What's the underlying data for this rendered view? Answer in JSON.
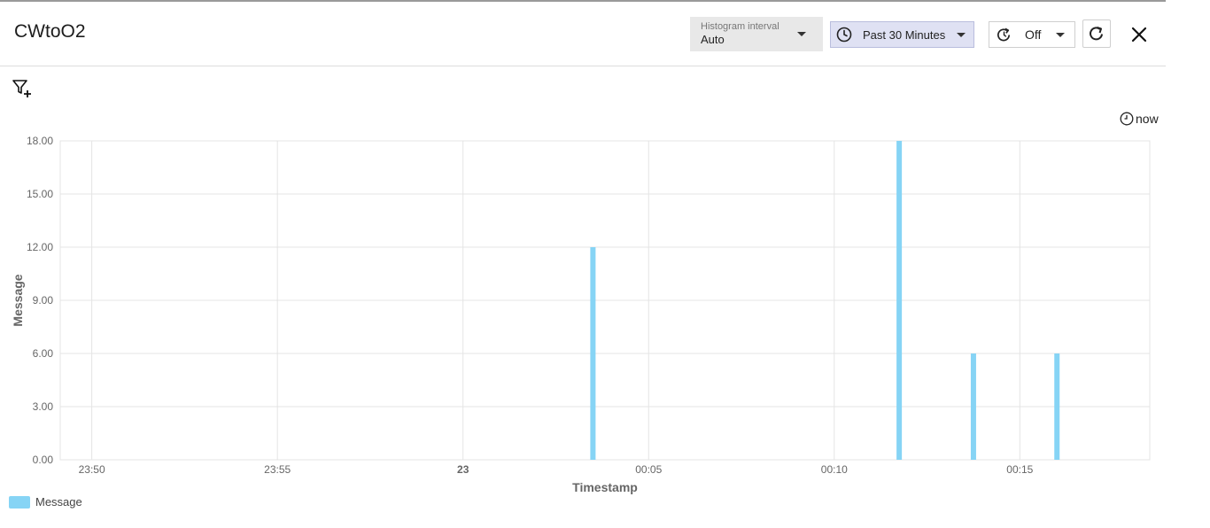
{
  "header": {
    "title": "CWtoO2",
    "histogram_interval": {
      "label": "Histogram interval",
      "value": "Auto"
    },
    "time_range": "Past 30 Minutes",
    "auto_refresh": "Off"
  },
  "icons": [
    "filter-add-icon",
    "clock-icon",
    "refresh-icon",
    "close-icon",
    "chevron-down-icon"
  ],
  "now_label": "now",
  "legend": {
    "label": "Message",
    "color": "#86d4f5"
  },
  "chart_data": {
    "type": "bar",
    "title": "",
    "xlabel": "Timestamp",
    "ylabel": "Message",
    "ylim": [
      0,
      18
    ],
    "y_ticks": [
      "0.00",
      "3.00",
      "6.00",
      "9.00",
      "12.00",
      "15.00",
      "18.00"
    ],
    "x_ticks": [
      "23:50",
      "23:55",
      "23",
      "00:05",
      "00:10",
      "00:15"
    ],
    "x_ticks_minutes": [
      0,
      5,
      10,
      15,
      20,
      25
    ],
    "x_range_minutes": [
      -0.85,
      28.5
    ],
    "grid": true,
    "series": [
      {
        "name": "Message",
        "color": "#86d4f5",
        "points": [
          {
            "t": "00:03:30",
            "minute": 13.5,
            "value": 12
          },
          {
            "t": "00:11:45",
            "minute": 21.75,
            "value": 18
          },
          {
            "t": "00:13:45",
            "minute": 23.75,
            "value": 6
          },
          {
            "t": "00:16:00",
            "minute": 26.0,
            "value": 6
          }
        ]
      }
    ]
  }
}
